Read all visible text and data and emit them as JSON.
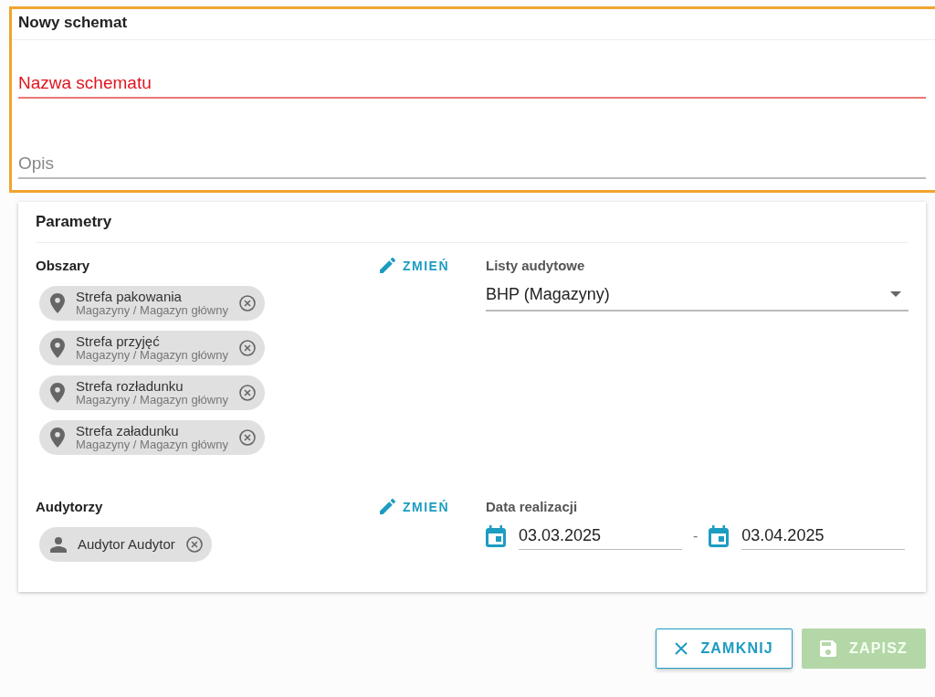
{
  "dialog": {
    "title": "Nowy schemat",
    "focused": true,
    "name_field": {
      "placeholder": "Nazwa schematu",
      "error": true
    },
    "description_field": {
      "placeholder": "Opis",
      "error": false
    }
  },
  "parameters": {
    "title": "Parametry",
    "areas": {
      "label": "Obszary",
      "change_button": "ZMIEŃ",
      "chips": [
        {
          "title": "Strefa pakowania",
          "subtitle": "Magazyny / Magazyn główny"
        },
        {
          "title": "Strefa przyjęć",
          "subtitle": "Magazyny / Magazyn główny"
        },
        {
          "title": "Strefa rozładunku",
          "subtitle": "Magazyny / Magazyn główny"
        },
        {
          "title": "Strefa załadunku",
          "subtitle": "Magazyny / Magazyn główny"
        }
      ]
    },
    "audit_lists": {
      "label": "Listy audytowe",
      "value": "BHP (Magazyny)"
    },
    "auditors": {
      "label": "Audytorzy",
      "change_button": "ZMIEŃ",
      "chips": [
        {
          "title": "Audytor Audytor"
        }
      ]
    },
    "date": {
      "label": "Data realizacji",
      "from": "03.03.2025",
      "separator": "-",
      "to": "03.04.2025"
    }
  },
  "buttons": [
    {
      "label": "ZAMKNIJ",
      "kind": "close",
      "disabled": false
    },
    {
      "label": "ZAPISZ",
      "kind": "save",
      "disabled": true
    }
  ]
}
